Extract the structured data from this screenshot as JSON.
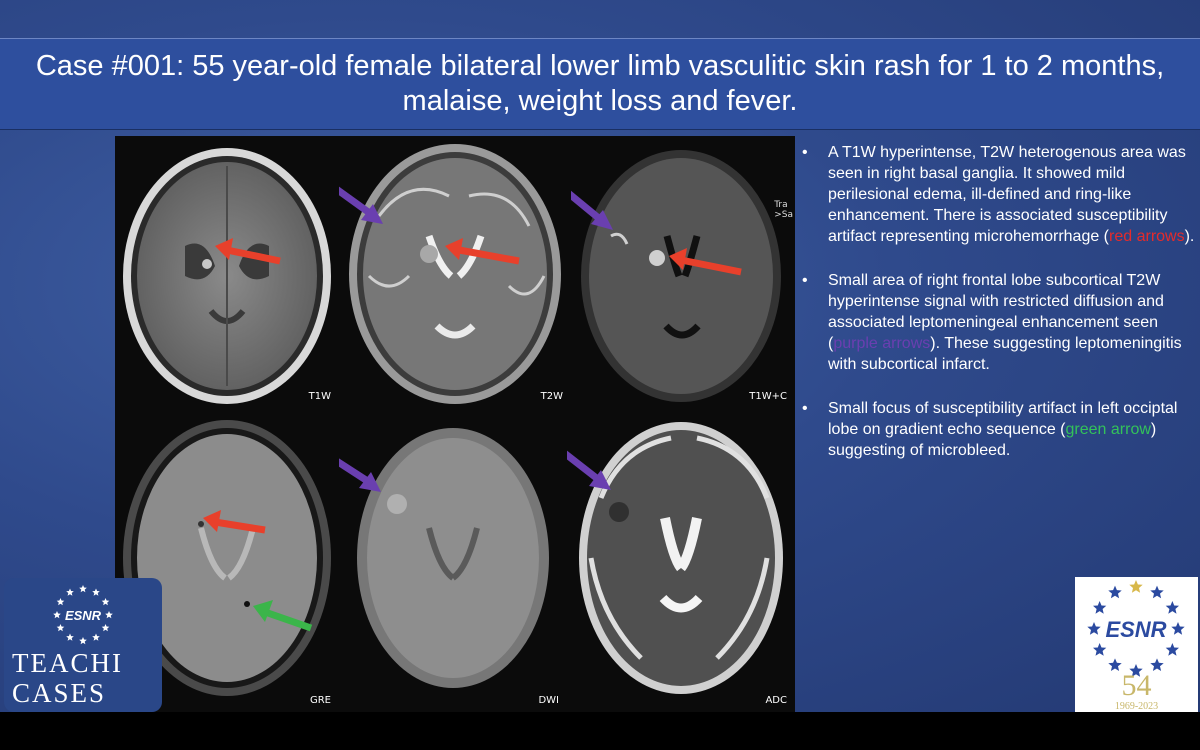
{
  "title": "Case #001: 55 year-old female bilateral lower limb vasculitic skin rash for 1 to 2 months, malaise, weight loss and fever.",
  "panels": [
    {
      "label": "T1W"
    },
    {
      "label": "T2W"
    },
    {
      "label": "T1W+C",
      "side_text": "Tra\n>Sa"
    },
    {
      "label": "GRE"
    },
    {
      "label": "DWI"
    },
    {
      "label": "ADC"
    }
  ],
  "bullets": [
    {
      "before": "A T1W hyperintense, T2W heterogenous area was seen in right basal ganglia. It showed mild perilesional edema, ill-defined and ring-like enhancement. There is associated susceptibility artifact representing microhemorrhage (",
      "highlight": "red arrows",
      "after": ")."
    },
    {
      "before": "Small area of right frontal lobe subcortical T2W hyperintense signal with restricted diffusion and associated leptomeningeal enhancement seen (",
      "highlight": "purple arrows",
      "after": "). These suggesting leptomeningitis with subcortical infarct."
    },
    {
      "before": "Small focus of susceptibility artifact in left occiptal lobe on gradient echo sequence (",
      "highlight": "green arrow",
      "after": ") suggesting of microbleed."
    }
  ],
  "bullet_symbol": "•",
  "logo_left": {
    "brand": "ESNR",
    "line1": "TEACHI",
    "line2": "CASES"
  },
  "logo_right": {
    "brand": "ESNR",
    "anniversary": "54",
    "years": "1969-2023"
  },
  "colors": {
    "slide_bg": "#2f4a8c",
    "title_band": "#2e4f9e",
    "arrow_red": "#e8402b",
    "arrow_purple": "#6a3fb0",
    "arrow_green": "#3bb54a",
    "star_blue": "#2b4aa0",
    "star_gold": "#d8b84a"
  }
}
